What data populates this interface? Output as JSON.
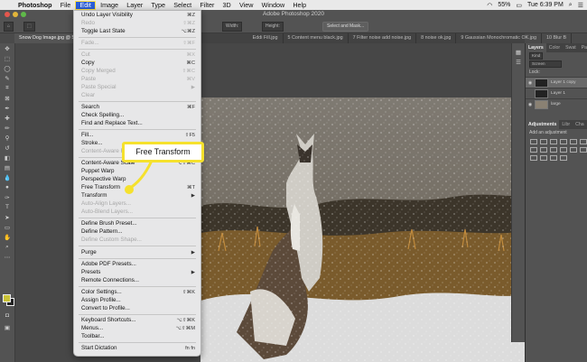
{
  "menubar": {
    "apple_glyph": "",
    "app_name": "Photoshop",
    "items": [
      "File",
      "Edit",
      "Image",
      "Layer",
      "Type",
      "Select",
      "Filter",
      "3D",
      "View",
      "Window",
      "Help"
    ],
    "battery": "55%",
    "clock": "Tue 6:39 PM"
  },
  "window": {
    "title": "Adobe Photoshop 2020"
  },
  "options_bar": {
    "width_label": "Width:",
    "height_label": "Height:",
    "select_mask_label": "Select and Mask..."
  },
  "doc_tabs": [
    "Snow Dog Image.jpg @ 50% (Layer 1 copy, RGB/8) *",
    "Eddi Fill.jpg",
    "5 Content menu black.jpg",
    "7 Filter noise add noise.jpg",
    "8 noise ok.jpg",
    "9 Gaussian Monochromatic OK.jpg",
    "10 Blur B"
  ],
  "edit_menu": {
    "items": [
      {
        "label": "Undo Layer Visibility",
        "shortcut": "⌘Z",
        "disabled": false
      },
      {
        "label": "Redo",
        "shortcut": "⇧⌘Z",
        "disabled": true
      },
      {
        "label": "Toggle Last State",
        "shortcut": "⌥⌘Z",
        "disabled": false
      },
      {
        "label": "Fade...",
        "shortcut": "⇧⌘F",
        "disabled": true
      },
      {
        "label": "Cut",
        "shortcut": "⌘X",
        "disabled": true
      },
      {
        "label": "Copy",
        "shortcut": "⌘C",
        "disabled": false
      },
      {
        "label": "Copy Merged",
        "shortcut": "⇧⌘C",
        "disabled": true
      },
      {
        "label": "Paste",
        "shortcut": "⌘V",
        "disabled": true
      },
      {
        "label": "Paste Special",
        "shortcut": "▶",
        "disabled": true
      },
      {
        "label": "Clear",
        "shortcut": "",
        "disabled": true
      },
      {
        "label": "Search",
        "shortcut": "⌘F",
        "disabled": false
      },
      {
        "label": "Check Spelling...",
        "shortcut": "",
        "disabled": false
      },
      {
        "label": "Find and Replace Text...",
        "shortcut": "",
        "disabled": false
      },
      {
        "label": "Fill...",
        "shortcut": "⇧F5",
        "disabled": false
      },
      {
        "label": "Stroke...",
        "shortcut": "",
        "disabled": false
      },
      {
        "label": "Content-Aware Fill...",
        "shortcut": "",
        "disabled": true
      },
      {
        "label": "Content-Aware Scale",
        "shortcut": "⌥⇧⌘C",
        "disabled": false
      },
      {
        "label": "Puppet Warp",
        "shortcut": "",
        "disabled": false
      },
      {
        "label": "Perspective Warp",
        "shortcut": "",
        "disabled": false
      },
      {
        "label": "Free Transform",
        "shortcut": "⌘T",
        "disabled": false
      },
      {
        "label": "Transform",
        "shortcut": "▶",
        "disabled": false
      },
      {
        "label": "Auto-Align Layers...",
        "shortcut": "",
        "disabled": true
      },
      {
        "label": "Auto-Blend Layers...",
        "shortcut": "",
        "disabled": true
      },
      {
        "label": "Define Brush Preset...",
        "shortcut": "",
        "disabled": false
      },
      {
        "label": "Define Pattern...",
        "shortcut": "",
        "disabled": false
      },
      {
        "label": "Define Custom Shape...",
        "shortcut": "",
        "disabled": true
      },
      {
        "label": "Purge",
        "shortcut": "▶",
        "disabled": false
      },
      {
        "label": "Adobe PDF Presets...",
        "shortcut": "",
        "disabled": false
      },
      {
        "label": "Presets",
        "shortcut": "▶",
        "disabled": false
      },
      {
        "label": "Remote Connections...",
        "shortcut": "",
        "disabled": false
      },
      {
        "label": "Color Settings...",
        "shortcut": "⇧⌘K",
        "disabled": false
      },
      {
        "label": "Assign Profile...",
        "shortcut": "",
        "disabled": false
      },
      {
        "label": "Convert to Profile...",
        "shortcut": "",
        "disabled": false
      },
      {
        "label": "Keyboard Shortcuts...",
        "shortcut": "⌥⇧⌘K",
        "disabled": false
      },
      {
        "label": "Menus...",
        "shortcut": "⌥⇧⌘M",
        "disabled": false
      },
      {
        "label": "Toolbar...",
        "shortcut": "",
        "disabled": false
      },
      {
        "label": "Start Dictation",
        "shortcut": "fn fn",
        "disabled": false
      }
    ]
  },
  "callout": {
    "text": "Free Transform",
    "color": "#f5e12d"
  },
  "panels": {
    "tabs": [
      "Layers",
      "Color",
      "Swat",
      "Path"
    ],
    "kind_label": "Kind",
    "blend_mode": "Screen",
    "lock_label": "Lock:",
    "layers": [
      "Layer 1 copy",
      "Layer 1",
      "large"
    ],
    "adjustments_tabs": [
      "Adjustments",
      "Libr",
      "Cha"
    ],
    "adjustments_hint": "Add an adjustment"
  },
  "colors": {
    "foreground": "#c9c236",
    "menu_highlight": "#2b5ed8"
  }
}
